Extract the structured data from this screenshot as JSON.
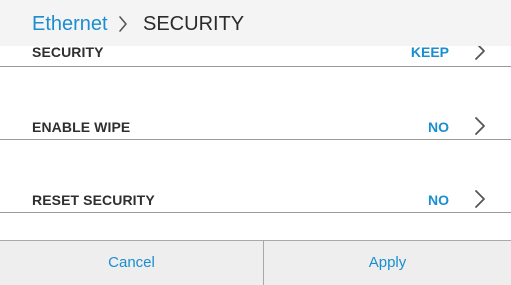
{
  "header": {
    "breadcrumb_parent": "Ethernet",
    "breadcrumb_current": "SECURITY",
    "separator_icon": "chevron-right-icon"
  },
  "settings": [
    {
      "label": "SECURITY",
      "value": "KEEP"
    },
    {
      "label": "ENABLE WIPE",
      "value": "NO"
    },
    {
      "label": "RESET SECURITY",
      "value": "NO"
    }
  ],
  "actions": {
    "cancel_label": "Cancel",
    "apply_label": "Apply"
  },
  "colors": {
    "accent": "#1a8ed0",
    "header_bg": "#f4f4f4",
    "action_bar_bg": "#eeeeee",
    "label_text": "#2f2f2f",
    "divider": "#9a9a9a"
  }
}
